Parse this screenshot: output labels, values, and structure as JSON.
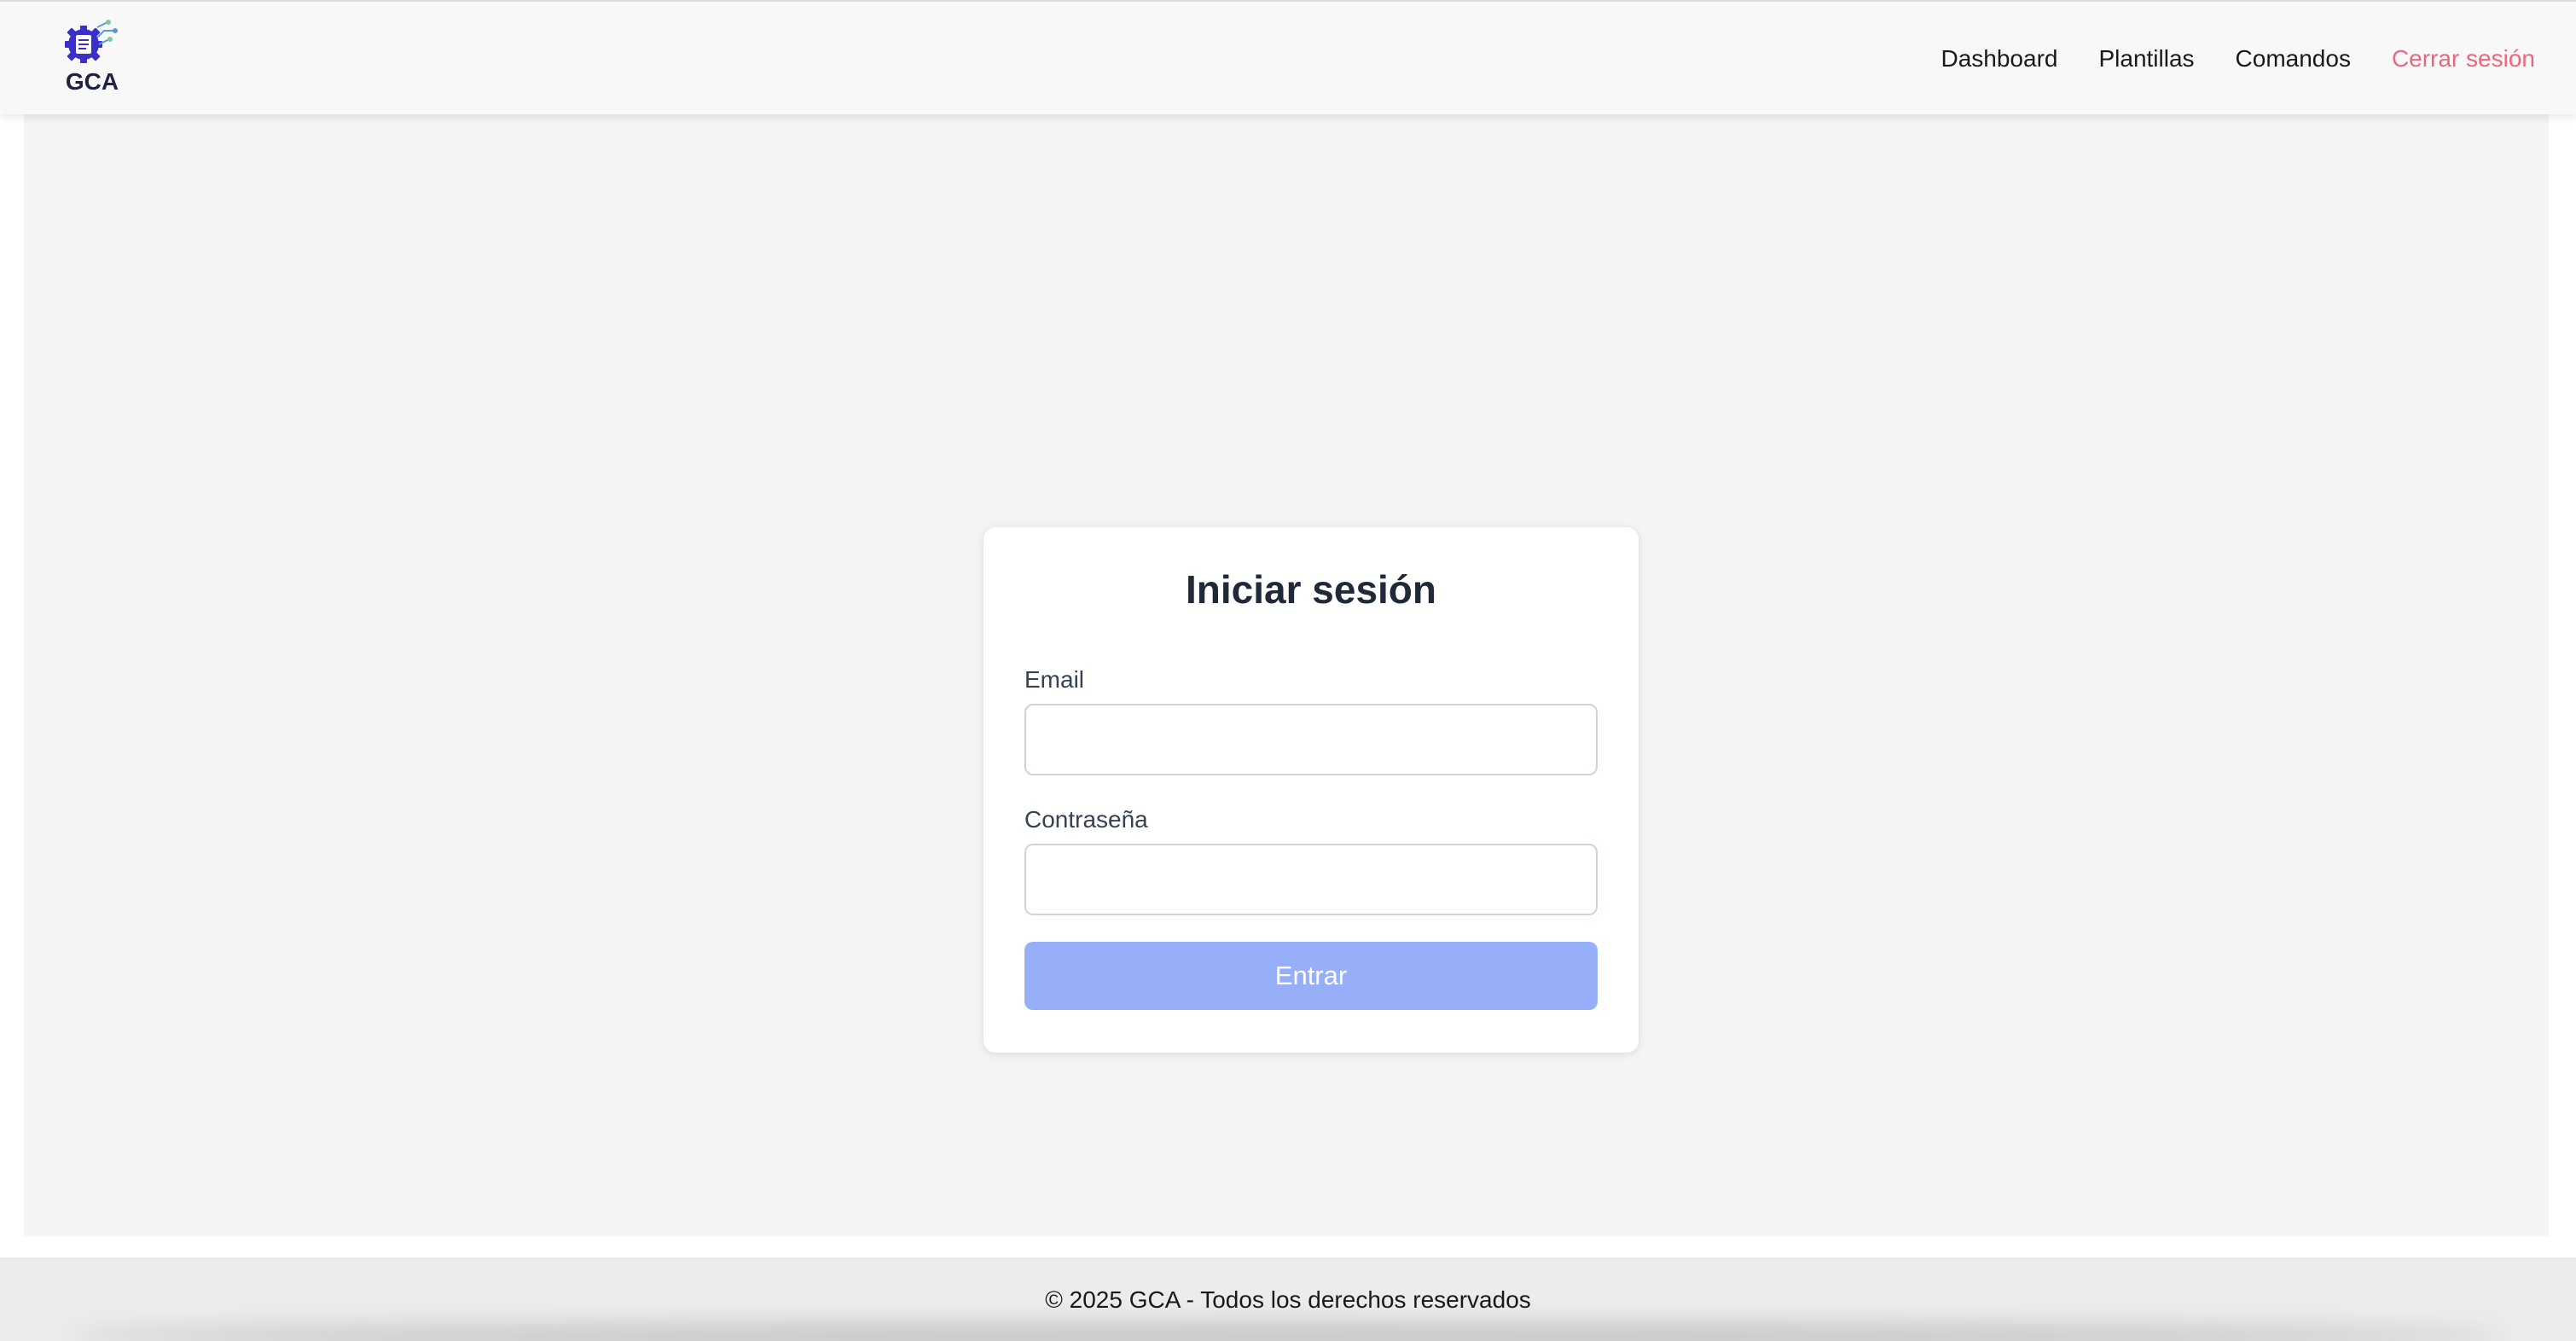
{
  "brand": {
    "logo_text": "GCA",
    "logo_color": "#3b3bd6"
  },
  "nav": {
    "dashboard": "Dashboard",
    "templates": "Plantillas",
    "commands": "Comandos",
    "logout": "Cerrar sesión"
  },
  "login": {
    "title": "Iniciar sesión",
    "email_label": "Email",
    "email_value": "",
    "password_label": "Contraseña",
    "password_value": "",
    "submit_label": "Entrar",
    "submit_color": "#97aef9"
  },
  "footer": {
    "text": "© 2025 GCA - Todos los derechos reservados"
  },
  "colors": {
    "logout": "#e8697c",
    "background": "#f3f4f6"
  }
}
